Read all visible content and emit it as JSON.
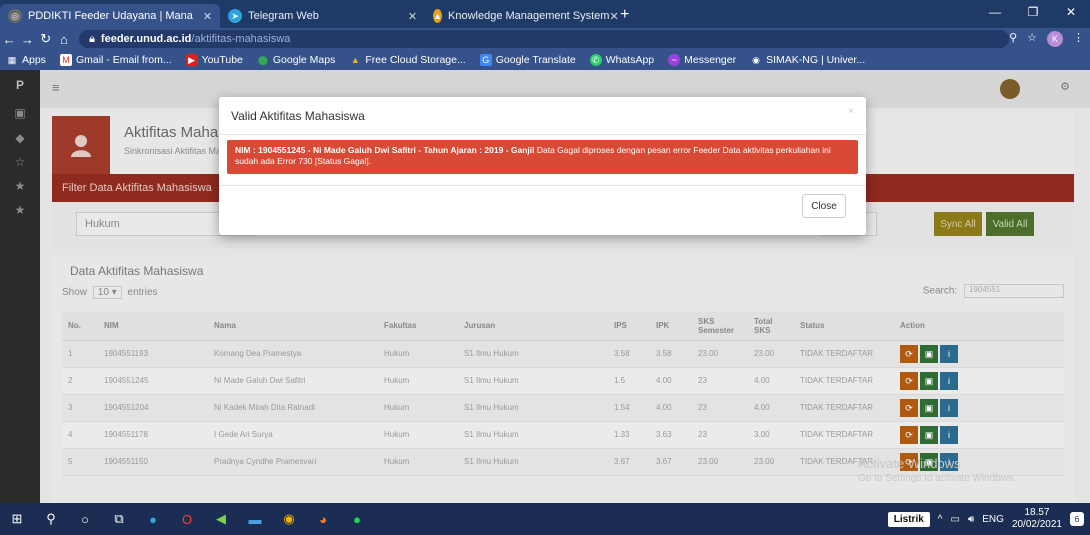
{
  "browser": {
    "tabs": [
      {
        "title": "PDDIKTI Feeder Udayana | Mana",
        "active": true
      },
      {
        "title": "Telegram Web",
        "active": false
      },
      {
        "title": "Knowledge Management System",
        "active": false
      }
    ],
    "url_host": "feeder.unud.ac.id",
    "url_path": "/aktifitas-mahasiswa",
    "profile_initial": "K",
    "bookmarks": [
      "Apps",
      "Gmail - Email from...",
      "YouTube",
      "Google Maps",
      "Free Cloud Storage...",
      "Google Translate",
      "WhatsApp",
      "Messenger",
      "SIMAK-NG | Univer..."
    ]
  },
  "app": {
    "brand": "P",
    "page_title": "Aktifitas Mahasiswa",
    "page_subtitle": "Sinkronisasi Aktifitas Mahasiswa",
    "filter_title": "Filter Data Aktifitas Mahasiswa",
    "filter_value": "Hukum",
    "sync_all": "Sync All",
    "valid_all": "Valid All",
    "data_title": "Data Aktifitas Mahasiswa",
    "show_label": "Show",
    "show_value": "10",
    "entries_label": "entries",
    "search_label": "Search:",
    "search_value": "1904551",
    "columns": [
      "No.",
      "NIM",
      "Nama",
      "Fakultas",
      "Jurusan",
      "IPS",
      "IPK",
      "SKS Semester",
      "Total SKS",
      "Status",
      "Action"
    ],
    "rows": [
      {
        "no": "1",
        "nim": "1904551193",
        "nama": "Komang Dea Pramestya",
        "fak": "Hukum",
        "jur": "S1 Ilmu Hukum",
        "ips": "3.58",
        "ipk": "3.58",
        "sks": "23.00",
        "tot": "23.00",
        "status": "TIDAK TERDAFTAR"
      },
      {
        "no": "2",
        "nim": "1904551245",
        "nama": "Ni Made Galuh Dwi Safitri",
        "fak": "Hukum",
        "jur": "S1 Ilmu Hukum",
        "ips": "1.5",
        "ipk": "4.00",
        "sks": "23",
        "tot": "4.00",
        "status": "TIDAK TERDAFTAR"
      },
      {
        "no": "3",
        "nim": "1904551204",
        "nama": "Ni Kadek Mirah Dita Ratnadi",
        "fak": "Hukum",
        "jur": "S1 Ilmu Hukum",
        "ips": "1.54",
        "ipk": "4.00",
        "sks": "23",
        "tot": "4.00",
        "status": "TIDAK TERDAFTAR"
      },
      {
        "no": "4",
        "nim": "1904551178",
        "nama": "I Gede Ari Surya",
        "fak": "Hukum",
        "jur": "S1 Ilmu Hukum",
        "ips": "1.33",
        "ipk": "3.63",
        "sks": "23",
        "tot": "3.00",
        "status": "TIDAK TERDAFTAR"
      },
      {
        "no": "5",
        "nim": "1904551150",
        "nama": "Pradnya Cyndhe Pramesvari",
        "fak": "Hukum",
        "jur": "S1 Ilmu Hukum",
        "ips": "3.67",
        "ipk": "3.67",
        "sks": "23.00",
        "tot": "23.00",
        "status": "TIDAK TERDAFTAR"
      }
    ]
  },
  "modal": {
    "title": "Valid Aktifitas Mahasiswa",
    "close_x": "×",
    "alert_bold": "NIM : 1904551245 - Ni Made Galuh Dwi Safitri - Tahun Ajaran : 2019 - Ganjil",
    "alert_text": " Data Gagal diproses dengan pesan error Feeder Data aktivitas perkuliahan ini sudah ada Error 730 [Status Gagal].",
    "close_button": "Close"
  },
  "watermark": {
    "line1": "Activate Windows",
    "line2": "Go to Settings to activate Windows."
  },
  "taskbar": {
    "keyboard": "Listrik",
    "lang": "ENG",
    "time": "18.57",
    "date": "20/02/2021",
    "notif_count": "6"
  }
}
